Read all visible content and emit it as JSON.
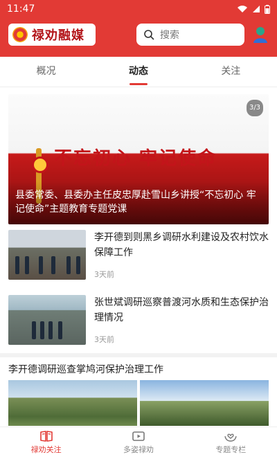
{
  "status": {
    "time": "11:47"
  },
  "app": {
    "logo_text": "禄劝融媒"
  },
  "search": {
    "placeholder": "搜索"
  },
  "tabs": [
    {
      "label": "概况"
    },
    {
      "label": "动态"
    },
    {
      "label": "关注"
    }
  ],
  "banner": {
    "slogan": "不忘初心 牢记使命",
    "indicator": "3/3",
    "caption": "县委常委、县委办主任皮忠厚赴雪山乡讲授“不忘初心 牢记使命”主题教育专题党课"
  },
  "news": [
    {
      "title": "李开德到则黑乡调研水利建设及农村饮水保障工作",
      "time": "3天前"
    },
    {
      "title": "张世斌调研巡察普渡河水质和生态保护治理情况",
      "time": "3天前"
    }
  ],
  "headline": "李开德调研巡查掌鸠河保护治理工作",
  "bottom_nav": [
    {
      "label": "禄劝关注"
    },
    {
      "label": "多姿禄劝"
    },
    {
      "label": "专题专栏"
    }
  ],
  "colors": {
    "accent": "#e23a35"
  }
}
